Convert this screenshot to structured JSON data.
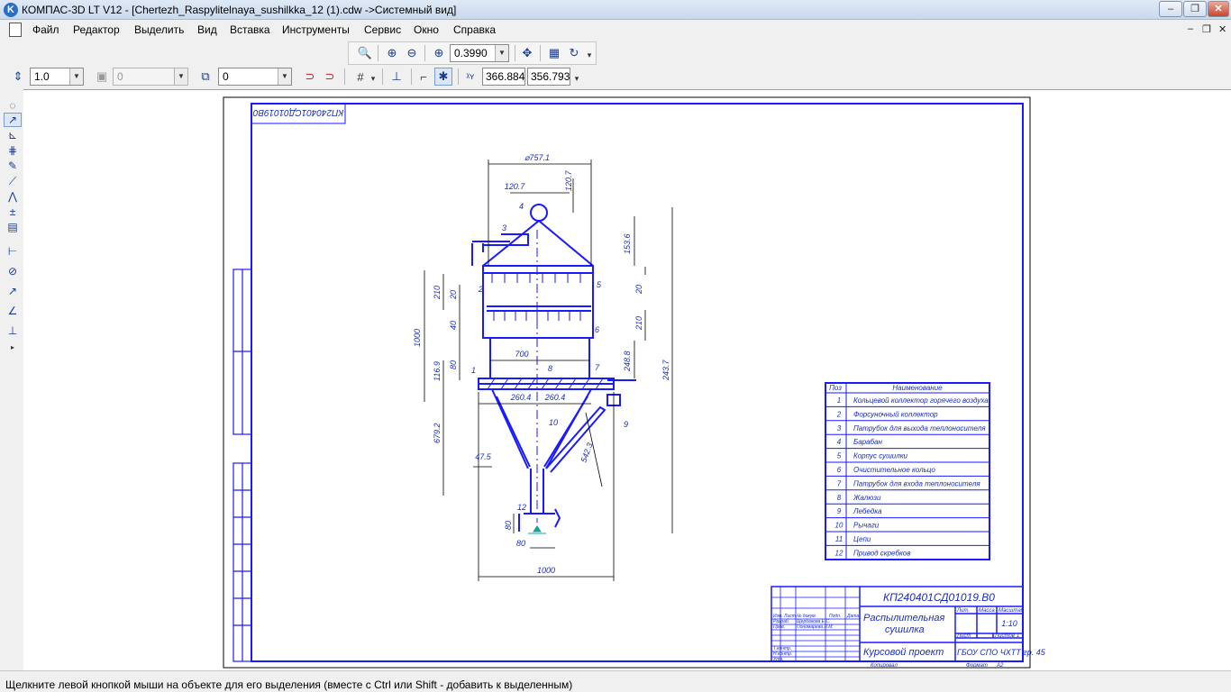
{
  "window": {
    "title": "КОМПАС-3D LT V12 - [Chertezh_Raspylitelnaya_sushilkka_12 (1).cdw ->Системный вид]",
    "app_icon_letter": "K",
    "minimize_label": "–",
    "maximize_label": "❐",
    "close_label": "✕"
  },
  "menu": {
    "items": [
      "Файл",
      "Редактор",
      "Выделить",
      "Вид",
      "Вставка",
      "Инструменты",
      "Сервис",
      "Окно",
      "Справка"
    ],
    "mdi_minimize": "–",
    "mdi_restore": "❐",
    "mdi_close": "✕"
  },
  "view_toolbar": {
    "zoom_value": "0.3990"
  },
  "current_toolbar": {
    "step_value": "1.0",
    "layer_value": "0",
    "style_value": "0",
    "coord_x": "366.884",
    "coord_y": "356.793"
  },
  "drawing": {
    "stamp_rotated": "КП240401СД01019В0",
    "designation": "КП240401СД01019.В0",
    "title_line1": "Распылительная",
    "title_line2": "сушилка",
    "doc_type": "Курсовой проект",
    "scale": "1:10",
    "org": "ГБОУ СПО ЧХТТ гр. 45",
    "sheet_label": "Лист",
    "sheets_label": "Листов",
    "sheets_value": "1",
    "lit_label": "Лит.",
    "mass_label": "Масса",
    "scale_label": "Масштаб",
    "copied_label": "Копировал",
    "format_label": "Формат",
    "format_value": "А2",
    "title_left_rows": [
      "Изм. Лист",
      "Разраб.",
      "Пров.",
      "Т.контр.",
      "Н.контр.",
      "Утв."
    ],
    "title_left_names": [
      "№ докум.",
      "Щербакова Е.С.",
      "Пономарева Л.М."
    ],
    "title_left_cols": [
      "Подп.",
      "Дата"
    ],
    "legend": {
      "col_pos": "Поз",
      "col_name": "Наименование",
      "rows": [
        {
          "pos": "1",
          "name": "Кольцевой коллектор горячего воздуха"
        },
        {
          "pos": "2",
          "name": "Форсуночный коллектор"
        },
        {
          "pos": "3",
          "name": "Патрубок для выхода теплоносителя"
        },
        {
          "pos": "4",
          "name": "Барабан"
        },
        {
          "pos": "5",
          "name": "Корпус сушилки"
        },
        {
          "pos": "6",
          "name": "Очистительное кольцо"
        },
        {
          "pos": "7",
          "name": "Патрубок для входа теплоносителя"
        },
        {
          "pos": "8",
          "name": "Жалюзи"
        },
        {
          "pos": "9",
          "name": "Лебедка"
        },
        {
          "pos": "10",
          "name": "Рычаги"
        },
        {
          "pos": "11",
          "name": "Цепи"
        },
        {
          "pos": "12",
          "name": "Привод скребков"
        }
      ]
    },
    "dims": {
      "d_top": "⌀757.1",
      "w_120": "120.7",
      "h_120": "120.7",
      "h_153": "153.6",
      "h_20a": "20",
      "h_210a": "210",
      "h_210b": "210",
      "h_20b": "20",
      "h_210c": "210",
      "h_40": "40",
      "h_80": "80",
      "h_1000": "1000",
      "h_116": "116.9",
      "h_2488": "248.8",
      "h_2437": "243.7",
      "w_700": "700",
      "w_2604a": "260.4",
      "w_2604b": "260.4",
      "h_679": "679.2",
      "w_475": "47.5",
      "h_5423": "542.3",
      "h_80b": "80",
      "w_80": "80",
      "w_1000": "1000"
    },
    "callouts": [
      "1",
      "2",
      "3",
      "4",
      "5",
      "6",
      "7",
      "8",
      "9",
      "10",
      "12"
    ]
  },
  "status": {
    "text": "Щелкните левой кнопкой мыши на объекте для его выделения (вместе с Ctrl или Shift - добавить к выделенным)"
  }
}
